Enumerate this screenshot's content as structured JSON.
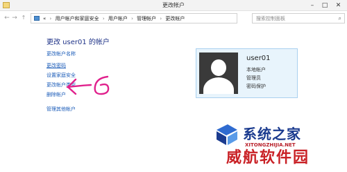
{
  "window": {
    "title": "更改帐户",
    "minimize_glyph": "–",
    "maximize_glyph": "□",
    "close_glyph": "✕"
  },
  "nav": {
    "back_glyph": "←",
    "forward_glyph": "→",
    "up_glyph": "↑",
    "breadcrumb_lead": "«",
    "breadcrumbs": [
      "用户帐户和家庭安全",
      "用户帐户",
      "管理帐户",
      "更改帐户"
    ],
    "separator": "›",
    "dropdown_glyph": "▾",
    "refresh_glyph": "↻",
    "search_placeholder": "搜索控制面板",
    "search_glyph": "⌕"
  },
  "main": {
    "heading": "更改 user01 的帐户",
    "tasks": [
      "更改帐户名称",
      "更改密码",
      "设置家庭安全",
      "更改帐户类型",
      "删除帐户",
      "管理其他帐户"
    ]
  },
  "user_card": {
    "name": "user01",
    "lines": [
      "本地帐户",
      "管理员",
      "密码保护"
    ]
  },
  "watermark": {
    "text": "系统之家",
    "url": "XITONGZHIJIA.NET",
    "subtext": "威航软件园"
  },
  "colors": {
    "link": "#1a5bb8",
    "heading": "#1e3287",
    "annotation": "#e0208c",
    "card_bg": "#e8f4fc"
  }
}
